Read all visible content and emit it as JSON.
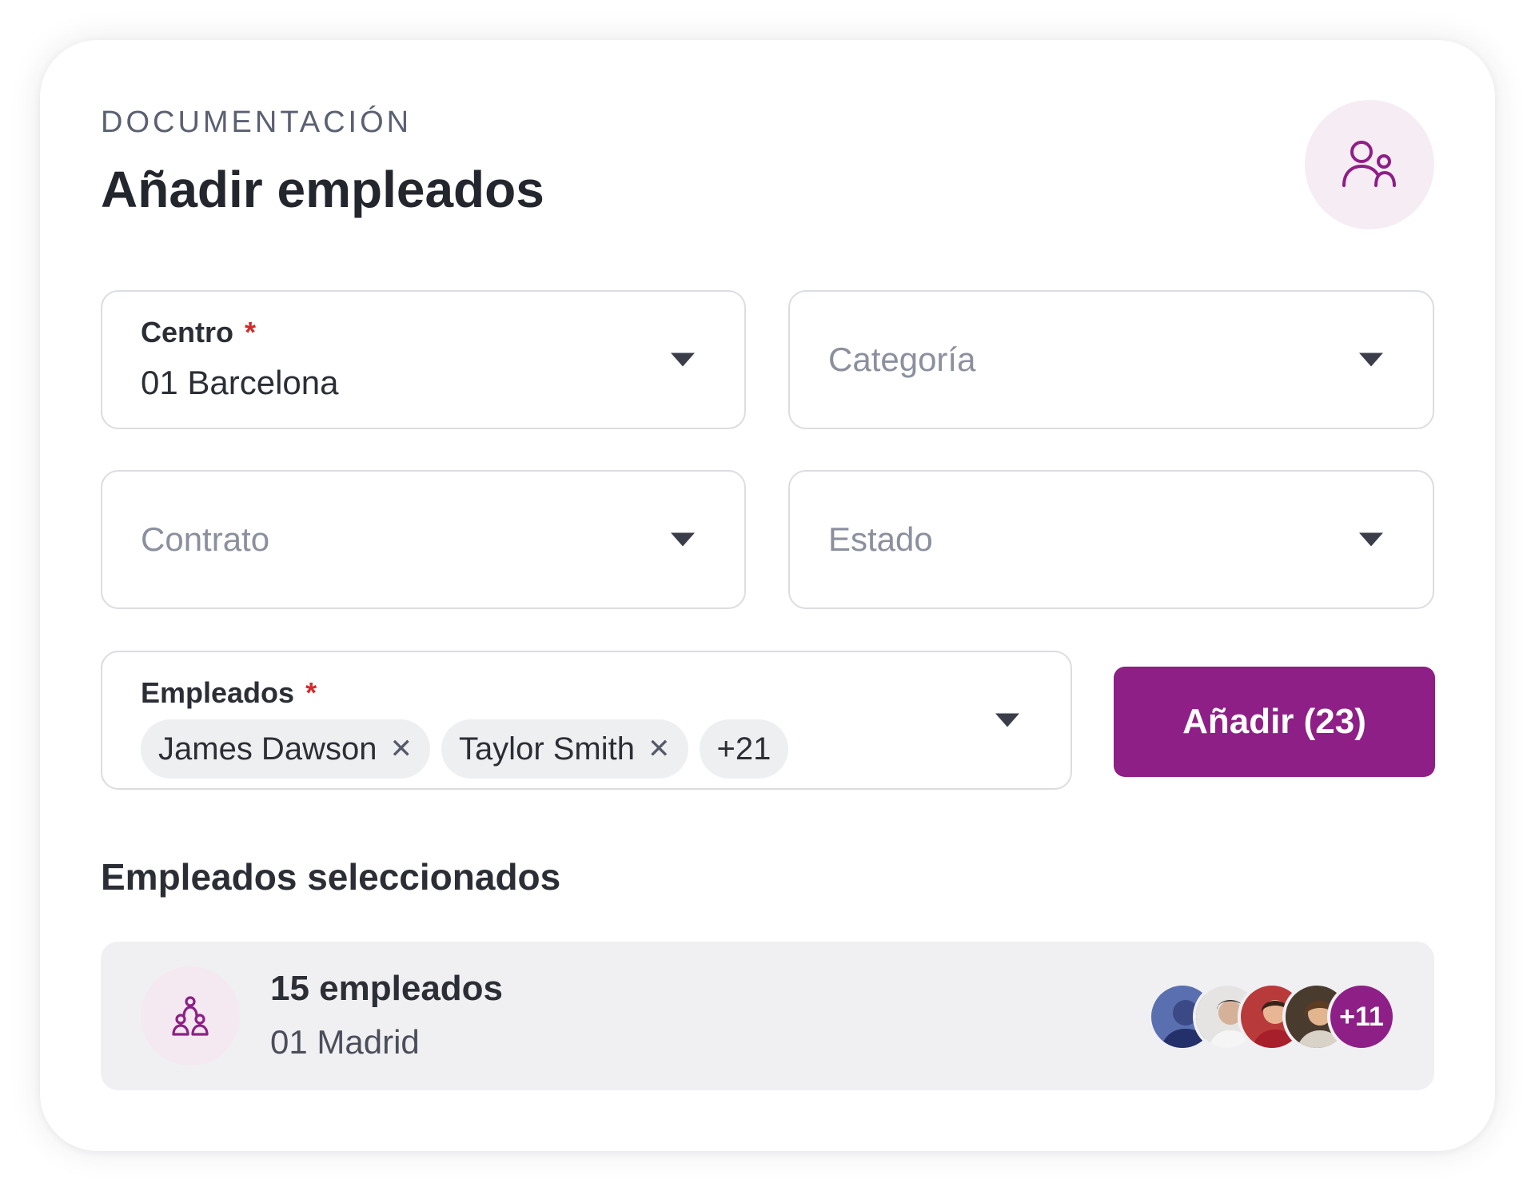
{
  "header": {
    "section_label": "DOCUMENTACIÓN",
    "title": "Añadir empleados",
    "icon": "users-icon"
  },
  "filters": {
    "centro": {
      "label": "Centro",
      "required_mark": "*",
      "value": "01 Barcelona"
    },
    "categoria": {
      "placeholder": "Categoría"
    },
    "contrato": {
      "placeholder": "Contrato"
    },
    "estado": {
      "placeholder": "Estado"
    }
  },
  "employees_field": {
    "label": "Empleados",
    "required_mark": "*",
    "chips": [
      "James Dawson",
      "Taylor Smith"
    ],
    "remove_glyph": "✕",
    "more_chip": "+21"
  },
  "add_button": {
    "label": "Añadir (23)"
  },
  "selected": {
    "heading": "Empleados seleccionados",
    "group": {
      "icon": "team-icon",
      "count_label": "15 empleados",
      "location": "01 Madrid",
      "avatars_more": "+11"
    }
  },
  "colors": {
    "accent": "#8e1f86",
    "accent_soft": "#f6ecf4",
    "required": "#d32b2b"
  }
}
